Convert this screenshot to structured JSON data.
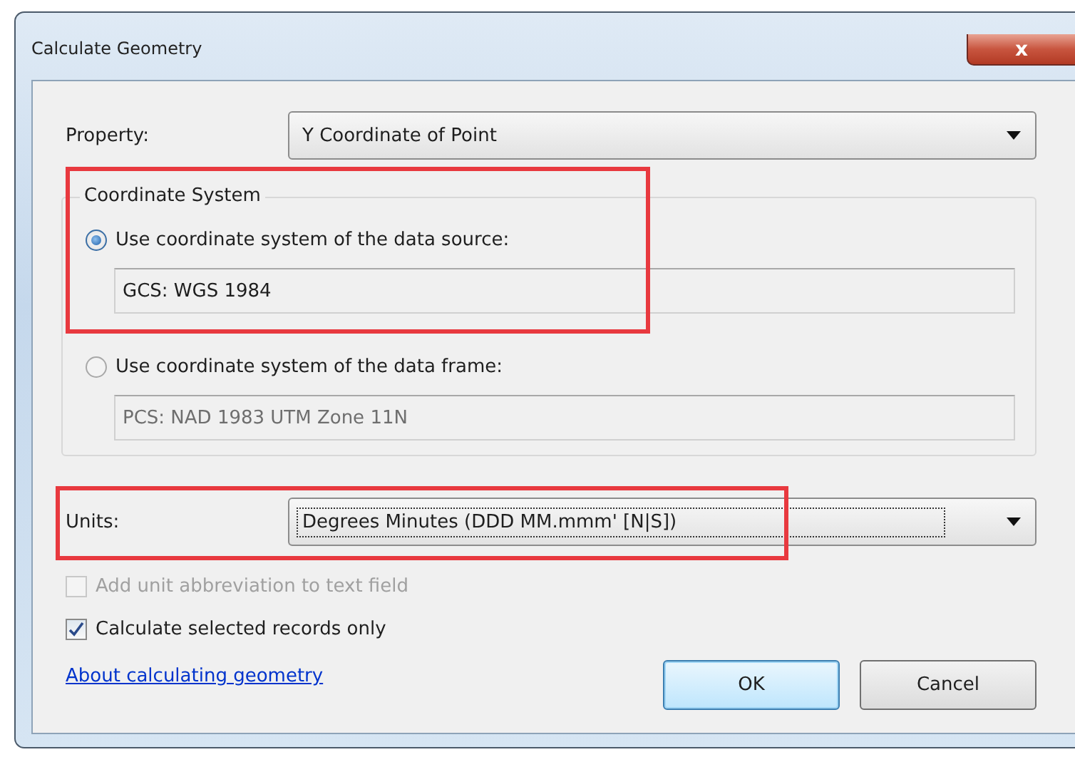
{
  "window": {
    "title": "Calculate Geometry",
    "close_label": "x"
  },
  "property": {
    "label": "Property:",
    "value": "Y Coordinate of Point"
  },
  "coordinate_system": {
    "title": "Coordinate System",
    "highlighted": true,
    "options": [
      {
        "label": "Use coordinate system of the data source:",
        "value": "GCS: WGS 1984",
        "selected": true
      },
      {
        "label": "Use coordinate system of the data frame:",
        "value": "PCS: NAD 1983 UTM Zone 11N",
        "selected": false
      }
    ]
  },
  "units": {
    "label": "Units:",
    "value": "Degrees Minutes (DDD MM.mmm' [N|S])",
    "focused": true,
    "highlighted": true
  },
  "checkboxes": [
    {
      "label": "Add unit abbreviation to text field",
      "checked": false,
      "disabled": true
    },
    {
      "label": "Calculate selected records only",
      "checked": true,
      "disabled": false
    }
  ],
  "link": "About calculating geometry",
  "buttons": [
    {
      "label": "OK",
      "default": true
    },
    {
      "label": "Cancel",
      "default": false
    }
  ]
}
